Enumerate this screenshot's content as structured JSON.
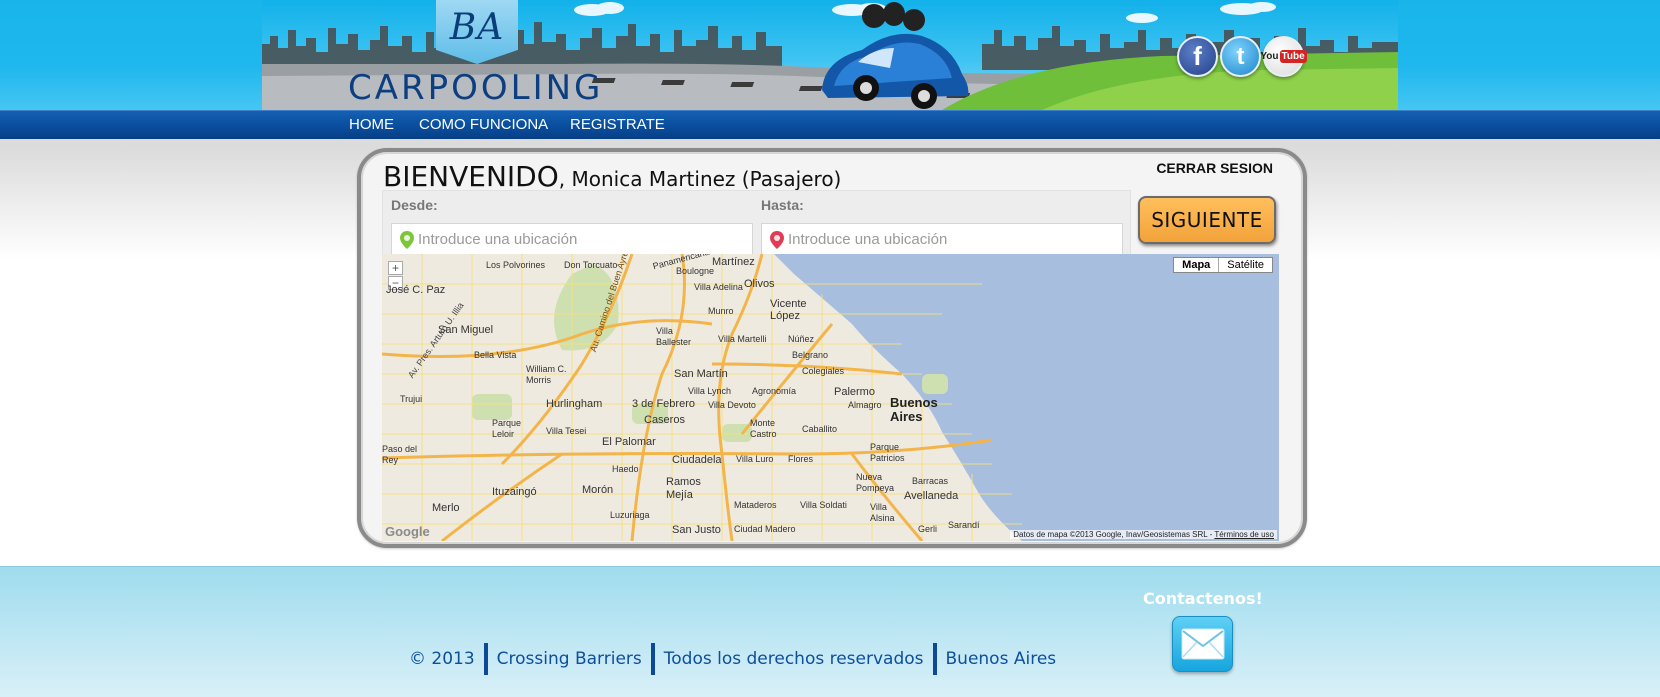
{
  "brand": {
    "badge": "BA",
    "name": "CARPOOLING"
  },
  "social": [
    {
      "name": "facebook",
      "glyph": "f"
    },
    {
      "name": "twitter",
      "glyph": "t"
    },
    {
      "name": "youtube",
      "glyph_a": "You",
      "glyph_b": "Tube"
    }
  ],
  "nav": {
    "home": "HOME",
    "how": "COMO FUNCIONA",
    "register": "REGISTRATE"
  },
  "panel": {
    "welcome": "BIENVENIDO",
    "user": ", Monica Martinez (Pasajero)",
    "logout": "CERRAR SESION",
    "from_label": "Desde:",
    "to_label": "Hasta:",
    "from_placeholder": "Introduce una ubicación",
    "to_placeholder": "Introduce una ubicación",
    "next_button": "SIGUIENTE"
  },
  "map": {
    "type_map": "Mapa",
    "type_satellite": "Satélite",
    "zoom_in": "+",
    "zoom_out": "−",
    "google": "Google",
    "credit": "Datos de mapa ©2013 Google, Inav/Geosistemas SRL - ",
    "terms": "Términos de uso",
    "places": {
      "martinez": "Martínez",
      "los_polvorines": "Los Polvorines",
      "don_torcuato": "Don Torcuato",
      "boulogne": "Boulogne",
      "villa_adelina": "Villa Adelina",
      "olivos": "Olivos",
      "vicente_lopez": "Vicente López",
      "munro": "Munro",
      "san_miguel": "San Miguel",
      "villa_ballester": "Villa Ballester",
      "villa_martelli": "Villa Martelli",
      "nunez": "Núñez",
      "bella_vista": "Bella Vista",
      "belgrano": "Belgrano",
      "william_morris": "William C. Morris",
      "san_martin": "San Martín",
      "colegiales": "Colegiales",
      "villa_lynch": "Villa Lynch",
      "agronomia": "Agronomía",
      "palermo": "Palermo",
      "hurlingham": "Hurlingham",
      "tres_febrero": "3 de Febrero",
      "villa_devoto": "Villa Devoto",
      "almagro": "Almagro",
      "buenos_aires": "Buenos Aires",
      "trujui": "Trujui",
      "parque_leloir": "Parque Leloir",
      "villa_tesei": "Villa Tesei",
      "caseros": "Caseros",
      "monte_castro": "Monte Castro",
      "caballito": "Caballito",
      "el_palomar": "El Palomar",
      "paso_del_rey": "Paso del Rey",
      "haedo": "Haedo",
      "ciudadela": "Ciudadela",
      "villa_luro": "Villa Luro",
      "flores": "Flores",
      "parque_patricios": "Parque Patricios",
      "ituzaingo": "Ituzaingó",
      "moron": "Morón",
      "ramos_mejia": "Ramos Mejía",
      "mataderos": "Mataderos",
      "villa_soldati": "Villa Soldati",
      "nueva_pompeya": "Nueva Pompeya",
      "barracas": "Barracas",
      "avellaneda": "Avellaneda",
      "merlo": "Merlo",
      "luzuriaga": "Luzuriaga",
      "villa_alsina": "Villa Alsina",
      "san_justo": "San Justo",
      "ciudad_madero": "Ciudad Madero",
      "gerli": "Gerli",
      "sarandi": "Sarandí",
      "jose_c_paz": "José C. Paz",
      "highway": "Au. Camino del Buen Ayre",
      "pres_peron": "Av. Pres. Arturo U. Illia",
      "panamericana": "Panamericana"
    }
  },
  "footer": {
    "copyright": "© 2013",
    "company": "Crossing Barriers",
    "rights": "Todos los derechos reservados",
    "city": "Buenos Aires",
    "contact_title": "Contactenos!"
  },
  "colors": {
    "header_blue": "#19b5ea",
    "nav_blue": "#0a4f9f",
    "button_orange": "#f3a23a",
    "footer_text": "#0c4f9c"
  }
}
